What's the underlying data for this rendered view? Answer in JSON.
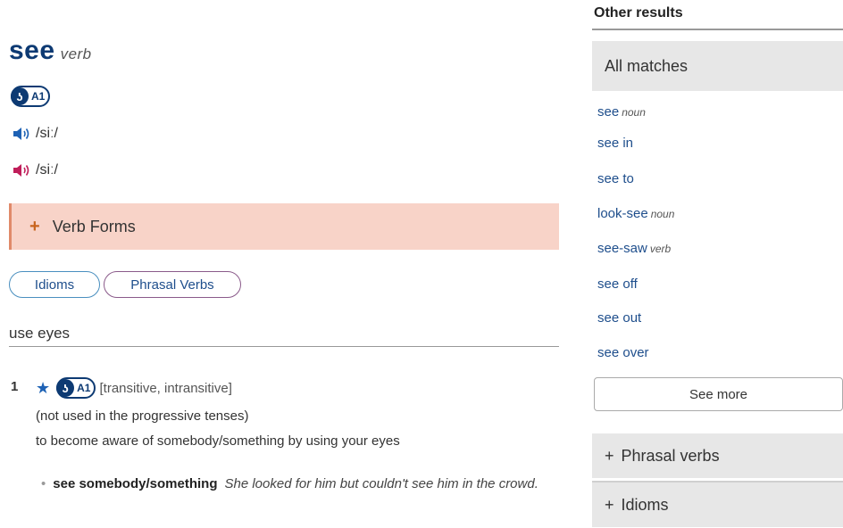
{
  "entry": {
    "headword": "see",
    "pos": "verb",
    "badge": {
      "key_icon": "oxford-3000-key-icon",
      "level": "A1"
    },
    "pronunciations": [
      {
        "ipa": "/siː/",
        "accent": "British",
        "color": "#1e62b5"
      },
      {
        "ipa": "/siː/",
        "accent": "American",
        "color": "#c01e5a"
      }
    ],
    "verb_forms": {
      "plus": "+",
      "label": "Verb Forms"
    },
    "pills": {
      "idioms": "Idioms",
      "phrasal": "Phrasal Verbs"
    },
    "section": "use eyes",
    "sense": {
      "num": "1",
      "level": "A1",
      "grammar": "[transitive, intransitive]",
      "note": "(not used in the progressive tenses)",
      "definition": "to become aware of somebody/something by using your eyes",
      "example": {
        "cf": "see somebody/something",
        "text": "She looked for him but couldn't see him in the crowd."
      }
    }
  },
  "sidebar": {
    "title": "Other results",
    "all_matches": "All matches",
    "results": [
      {
        "word": "see",
        "pos": "noun"
      },
      {
        "word": "see in",
        "pos": ""
      },
      {
        "word": "see to",
        "pos": ""
      },
      {
        "word": "look-see",
        "pos": "noun"
      },
      {
        "word": "see-saw",
        "pos": "verb"
      },
      {
        "word": "see off",
        "pos": ""
      },
      {
        "word": "see out",
        "pos": ""
      },
      {
        "word": "see over",
        "pos": ""
      }
    ],
    "see_more": "See more",
    "phrasal_verbs": "Phrasal verbs",
    "idioms": "Idioms",
    "plus": "+"
  },
  "colors": {
    "headword": "#0d3a73",
    "link": "#1e4e8c",
    "verbforms_bg": "#f8d3c8",
    "sidebar_panel": "#e7e7e7"
  }
}
